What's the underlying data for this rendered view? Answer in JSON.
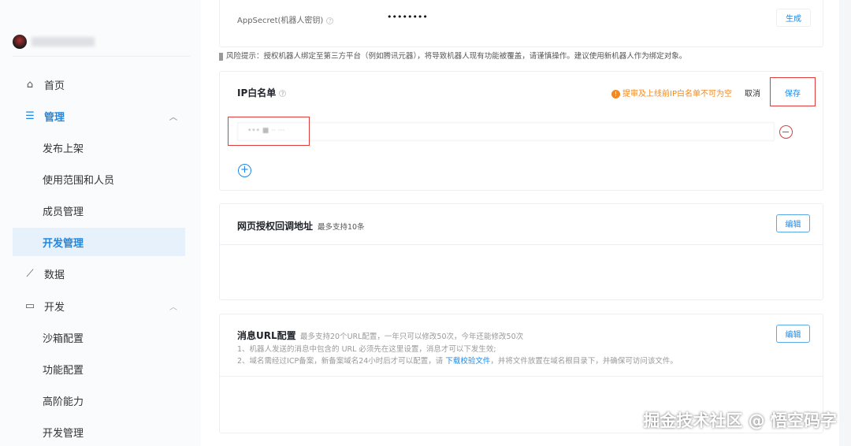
{
  "sidebar": {
    "items": [
      {
        "label": "首页",
        "icon": "home-icon"
      },
      {
        "label": "管理",
        "icon": "list-icon"
      },
      {
        "label": "发布上架"
      },
      {
        "label": "使用范围和人员"
      },
      {
        "label": "成员管理"
      },
      {
        "label": "开发管理"
      },
      {
        "label": "数据",
        "icon": "chart-icon"
      },
      {
        "label": "开发",
        "icon": "monitor-icon"
      },
      {
        "label": "沙箱配置"
      },
      {
        "label": "功能配置"
      },
      {
        "label": "高阶能力"
      },
      {
        "label": "开发管理"
      }
    ]
  },
  "secret": {
    "label": "AppSecret(机器人密钥)",
    "value": "••••••••",
    "button": "生成"
  },
  "risk": "风险提示：授权机器人绑定至第三方平台（例如腾讯元器），将导致机器人现有功能被覆盖，请谨慎操作。建议使用新机器人作为绑定对象。",
  "ip": {
    "title": "IP白名单",
    "warning": "提审及上线前IP白名单不可为空",
    "cancel": "取消",
    "save": "保存",
    "entry": "••• ■ ·· ···"
  },
  "web": {
    "title": "网页授权回调地址",
    "sub": "最多支持10条",
    "edit": "编辑"
  },
  "msg": {
    "title": "消息URL配置",
    "sub": "最多支持20个URL配置，一年只可以修改50次，今年还能修改50次",
    "line1": "1、机器人发送的消息中包含的 URL 必须先在这里设置，消息才可以下发生效;",
    "line2_pre": "2、域名需经过ICP备案，新备案域名24小时后才可以配置，请 ",
    "link": "下载校验文件",
    "line2_post": "，并将文件放置在域名根目录下，并确保可访问该文件。",
    "edit": "编辑"
  },
  "watermark": "掘金技术社区 @ 悟空码字"
}
